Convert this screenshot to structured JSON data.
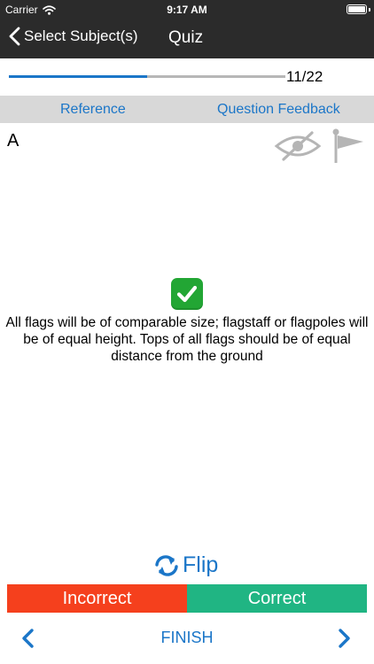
{
  "status_bar": {
    "carrier": "Carrier",
    "time": "9:17 AM",
    "icons": [
      "wifi-icon",
      "battery-icon"
    ]
  },
  "nav": {
    "back_label": "Select Subject(s)",
    "title": "Quiz"
  },
  "progress": {
    "text": "11/22",
    "fraction": 0.5
  },
  "tabs": {
    "reference": "Reference",
    "feedback": "Question Feedback"
  },
  "card": {
    "side_label": "A",
    "answer": "All flags will be of comparable size; flagstaff or flagpoles will be of equal height. Tops of all flags should be of equal distance from the ground",
    "icons": [
      "check-mark-icon",
      "hide-eye-icon",
      "flag-icon"
    ]
  },
  "actions": {
    "flip": "Flip",
    "incorrect": "Incorrect",
    "correct": "Correct",
    "finish": "FINISH"
  },
  "colors": {
    "bar_background": "#2b2b2b",
    "accent_blue": "#1b76c8",
    "incorrect_red": "#f5401d",
    "correct_green": "#20b583",
    "check_green": "#22a634",
    "tab_background": "#d8d8d8",
    "icon_gray": "#b5b5b5"
  }
}
